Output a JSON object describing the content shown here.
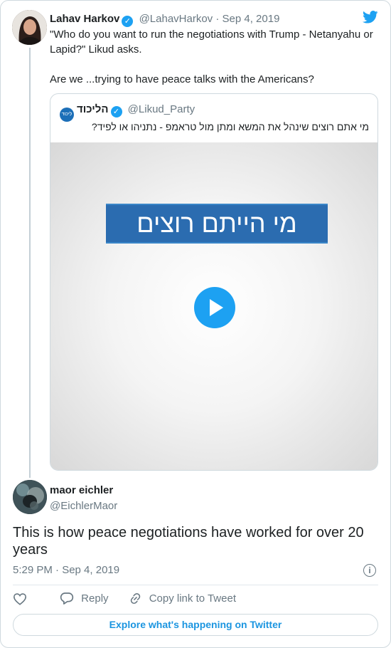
{
  "tweet": {
    "author_name": "Lahav Harkov",
    "author_handle": "@LahavHarkov",
    "date": "Sep 4, 2019",
    "line1": "\"Who do you want to run the negotiations with Trump - Netanyahu or Lapid?\" Likud asks.",
    "line2": "Are we ...trying to have peace talks with the Americans?"
  },
  "quote": {
    "name": "הליכוד",
    "handle": "@Likud_Party",
    "text": "מי אתם רוצים שינהל את המשא ומתן מול טראמפ - נתניהו או לפיד?",
    "video_banner": "מי הייתם רוצים"
  },
  "reply": {
    "author_name": "maor eichler",
    "author_handle": "@EichlerMaor",
    "text": "This is how peace negotiations have worked for over 20 years",
    "timestamp": "5:29 PM · Sep 4, 2019"
  },
  "actions": {
    "reply_label": "Reply",
    "copy_label": "Copy link to Tweet"
  },
  "explore_label": "Explore what's happening on Twitter",
  "icons": [
    "verified-icon",
    "twitter-bird-icon",
    "play-icon",
    "info-icon",
    "heart-icon",
    "reply-icon",
    "link-icon"
  ],
  "colors": {
    "accent": "#1da1f2",
    "link": "#1b95e0",
    "muted": "#697882"
  }
}
